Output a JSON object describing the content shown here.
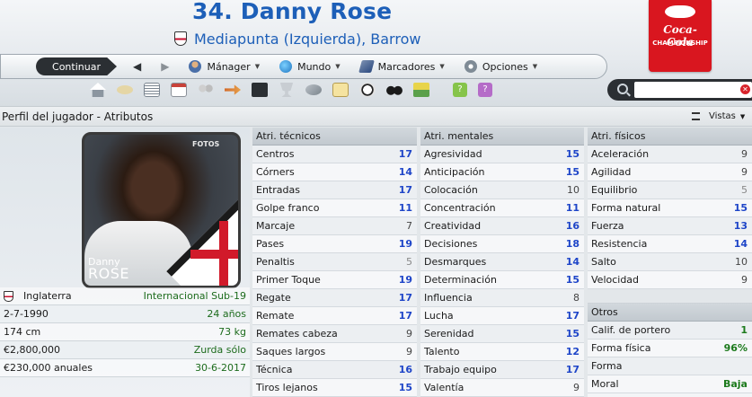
{
  "header": {
    "player_title": "34. Danny Rose",
    "player_sub": "Mediapunta (Izquierda), Barrow"
  },
  "sponsor": {
    "top": "Coca-Cola",
    "sub": "CHAMPIONSHIP"
  },
  "nav": {
    "continue_label": "Continuar",
    "menus": [
      {
        "label": "Mánager",
        "icon": "person-icon"
      },
      {
        "label": "Mundo",
        "icon": "globe-icon"
      },
      {
        "label": "Marcadores",
        "icon": "bookmark-icon"
      },
      {
        "label": "Opciones",
        "icon": "gear-icon"
      }
    ]
  },
  "search": {
    "placeholder": "",
    "value": ""
  },
  "toolbar_icons": [
    "home-icon",
    "news-icon",
    "list-icon",
    "calendar-icon",
    "people-icon",
    "transfer-icon",
    "tactics-icon",
    "trophy-icon",
    "scout-icon",
    "clipboard-icon",
    "football-icon",
    "binoculars-icon",
    "finance-icon",
    "help-icon",
    "help-purple-icon"
  ],
  "section": {
    "title": "Perfil del jugador - Atributos",
    "views_label": "Vistas"
  },
  "profile": {
    "photo_credit": "FOTOS",
    "first_name": "Danny",
    "last_name": "ROSE",
    "nation": "Inglaterra",
    "intl_status": "Internacional Sub-19",
    "dob": "2-7-1990",
    "age": "24 años",
    "height": "174 cm",
    "weight": "73 kg",
    "value": "€2,800,000",
    "foot": "Zurda sólo",
    "wage": "€230,000 anuales",
    "contract_end": "30-6-2017"
  },
  "technical": {
    "title": "Atri. técnicos",
    "rows": [
      {
        "name": "Centros",
        "value": "17"
      },
      {
        "name": "Córners",
        "value": "14"
      },
      {
        "name": "Entradas",
        "value": "17"
      },
      {
        "name": "Golpe franco",
        "value": "11"
      },
      {
        "name": "Marcaje",
        "value": "7"
      },
      {
        "name": "Pases",
        "value": "19"
      },
      {
        "name": "Penaltis",
        "value": "5"
      },
      {
        "name": "Primer Toque",
        "value": "19"
      },
      {
        "name": "Regate",
        "value": "17"
      },
      {
        "name": "Remate",
        "value": "17"
      },
      {
        "name": "Remates cabeza",
        "value": "9"
      },
      {
        "name": "Saques largos",
        "value": "9"
      },
      {
        "name": "Técnica",
        "value": "16"
      },
      {
        "name": "Tiros lejanos",
        "value": "15"
      }
    ]
  },
  "mental": {
    "title": "Atri. mentales",
    "rows": [
      {
        "name": "Agresividad",
        "value": "15"
      },
      {
        "name": "Anticipación",
        "value": "15"
      },
      {
        "name": "Colocación",
        "value": "10"
      },
      {
        "name": "Concentración",
        "value": "11"
      },
      {
        "name": "Creatividad",
        "value": "16"
      },
      {
        "name": "Decisiones",
        "value": "18"
      },
      {
        "name": "Desmarques",
        "value": "14"
      },
      {
        "name": "Determinación",
        "value": "15"
      },
      {
        "name": "Influencia",
        "value": "8"
      },
      {
        "name": "Lucha",
        "value": "17"
      },
      {
        "name": "Serenidad",
        "value": "15"
      },
      {
        "name": "Talento",
        "value": "12"
      },
      {
        "name": "Trabajo equipo",
        "value": "17"
      },
      {
        "name": "Valentía",
        "value": "9"
      }
    ]
  },
  "physical": {
    "title": "Atri. físicos",
    "rows": [
      {
        "name": "Aceleración",
        "value": "9"
      },
      {
        "name": "Agilidad",
        "value": "9"
      },
      {
        "name": "Equilibrio",
        "value": "5"
      },
      {
        "name": "Forma natural",
        "value": "15"
      },
      {
        "name": "Fuerza",
        "value": "13"
      },
      {
        "name": "Resistencia",
        "value": "14"
      },
      {
        "name": "Salto",
        "value": "10"
      },
      {
        "name": "Velocidad",
        "value": "9"
      }
    ]
  },
  "others": {
    "title": "Otros",
    "rows": [
      {
        "name": "Calif. de portero",
        "value": "1"
      },
      {
        "name": "Forma física",
        "value": "96%"
      },
      {
        "name": "Forma",
        "value": ""
      },
      {
        "name": "Moral",
        "value": "Baja"
      }
    ]
  }
}
